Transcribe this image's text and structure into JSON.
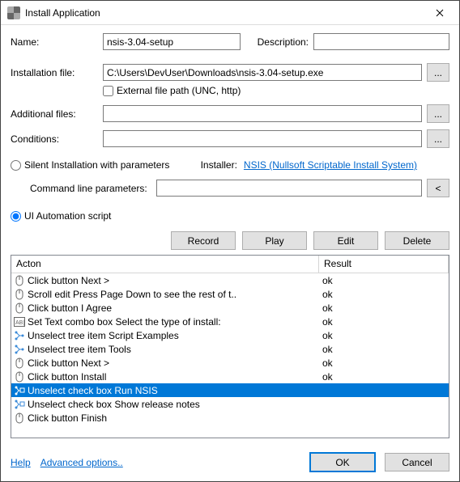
{
  "window": {
    "title": "Install Application"
  },
  "labels": {
    "name": "Name:",
    "description": "Description:",
    "installation_file": "Installation file:",
    "external_file_path": "External file path (UNC, http)",
    "additional_files": "Additional files:",
    "conditions": "Conditions:",
    "silent_install": "Silent Installation with parameters",
    "installer": "Installer:",
    "installer_link": "NSIS (Nullsoft Scriptable Install System)",
    "cmd_params": "Command line parameters:",
    "ui_automation": "UI Automation script",
    "help": "Help",
    "advanced": "Advanced options.."
  },
  "fields": {
    "name": "nsis-3.04-setup",
    "description": "",
    "installation_file": "C:\\Users\\DevUser\\Downloads\\nsis-3.04-setup.exe",
    "additional_files": "",
    "conditions": "",
    "cmd_params": ""
  },
  "buttons": {
    "browse": "...",
    "history": "<",
    "record": "Record",
    "play": "Play",
    "edit": "Edit",
    "delete": "Delete",
    "ok": "OK",
    "cancel": "Cancel"
  },
  "table": {
    "headers": {
      "action": "Acton",
      "result": "Result"
    },
    "rows": [
      {
        "icon": "mouse",
        "action": "Click button Next >",
        "result": "ok",
        "selected": false
      },
      {
        "icon": "mouse",
        "action": "Scroll edit Press Page Down to see the rest of t..",
        "result": "ok",
        "selected": false
      },
      {
        "icon": "mouse",
        "action": "Click button I Agree",
        "result": "ok",
        "selected": false
      },
      {
        "icon": "text",
        "action": "Set Text combo box Select the type of install:",
        "result": "ok",
        "selected": false
      },
      {
        "icon": "tree",
        "action": "Unselect tree item Script Examples",
        "result": "ok",
        "selected": false
      },
      {
        "icon": "tree",
        "action": "Unselect tree item Tools",
        "result": "ok",
        "selected": false
      },
      {
        "icon": "mouse",
        "action": "Click button Next >",
        "result": "ok",
        "selected": false
      },
      {
        "icon": "mouse",
        "action": "Click button Install",
        "result": "ok",
        "selected": false
      },
      {
        "icon": "check",
        "action": "Unselect check box Run NSIS",
        "result": "",
        "selected": true
      },
      {
        "icon": "check",
        "action": "Unselect check box Show release notes",
        "result": "",
        "selected": false
      },
      {
        "icon": "mouse",
        "action": "Click button Finish",
        "result": "",
        "selected": false
      }
    ]
  }
}
